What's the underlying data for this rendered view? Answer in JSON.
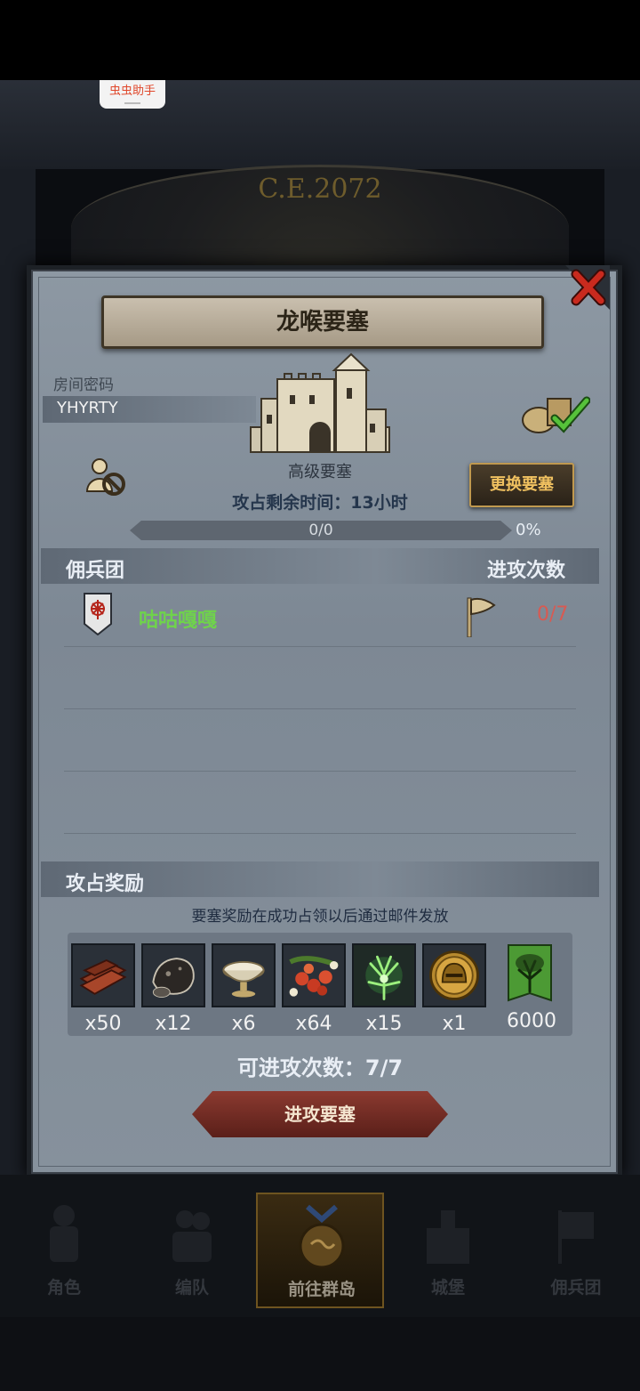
{
  "assistant_tag": "虫虫助手",
  "background": {
    "year_text": "C.E.2072"
  },
  "dialog": {
    "title": "龙喉要塞",
    "room_password_label": "房间密码",
    "room_password_value": "YHYRTY",
    "fortress_grade": "高级要塞",
    "timer_text": "攻占剩余时间：13小时",
    "change_button": "更换要塞",
    "progress": {
      "text": "0/0",
      "percent_text": "0%",
      "percent": 0
    },
    "guild_header": "佣兵团",
    "attacks_header": "进攻次数",
    "guilds": [
      {
        "name": "咕咕嘎嘎",
        "attacks": "0/7"
      }
    ],
    "reward_header": "攻占奖励",
    "reward_note": "要塞奖励在成功占领以后通过邮件发放",
    "rewards": [
      {
        "icon": "wood-planks-icon",
        "qty": "x50"
      },
      {
        "icon": "ore-rock-icon",
        "qty": "x12"
      },
      {
        "icon": "silver-bowl-icon",
        "qty": "x6"
      },
      {
        "icon": "berries-icon",
        "qty": "x64"
      },
      {
        "icon": "green-essence-icon",
        "qty": "x15"
      },
      {
        "icon": "gold-helmet-coin-icon",
        "qty": "x1"
      }
    ],
    "banner_reward": {
      "icon": "guild-banner-tree-icon",
      "qty": "6000"
    },
    "available_attacks": "可进攻次数：7/7",
    "attack_button": "进攻要塞"
  },
  "bottom_nav": [
    {
      "label": "角色",
      "icon": "knight-icon"
    },
    {
      "label": "编队",
      "icon": "squad-icon"
    },
    {
      "label": "前往群岛",
      "icon": "islands-icon",
      "active": true
    },
    {
      "label": "城堡",
      "icon": "castle-icon"
    },
    {
      "label": "佣兵团",
      "icon": "mercenary-icon"
    }
  ],
  "colors": {
    "guild_name": "#6fd24c",
    "attack_count": "#d85a52",
    "change_button_text": "#f0c160"
  }
}
